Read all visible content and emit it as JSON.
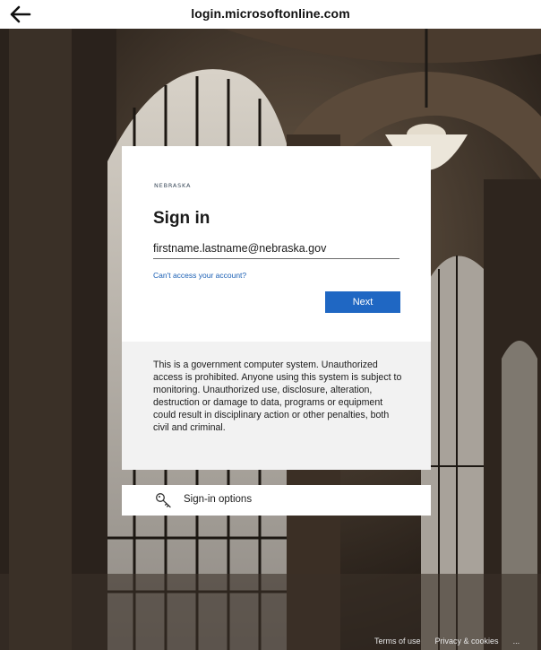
{
  "address_bar": {
    "back_icon": "arrow-left-icon",
    "url": "login.microsoftonline.com"
  },
  "signin_card": {
    "org_logo_text": "NEBRASKA",
    "title": "Sign in",
    "email_value": "firstname.lastname@nebraska.gov",
    "cant_access_link": "Can't access your account?",
    "next_button": "Next"
  },
  "notice": {
    "text": "This is a government computer system. Unauthorized access is prohibited. Anyone using this system is subject to monitoring. Unauthorized use, disclosure, alteration, destruction or damage to data, programs or equipment could result in disciplinary action or other penalties, both civil and criminal."
  },
  "signin_options": {
    "icon": "key-icon",
    "label": "Sign-in options"
  },
  "footer": {
    "terms": "Terms of use",
    "privacy": "Privacy & cookies",
    "more": "..."
  },
  "colors": {
    "accent": "#1f67c3",
    "link": "#1a5fb4",
    "notice_bg": "#f2f2f2"
  }
}
